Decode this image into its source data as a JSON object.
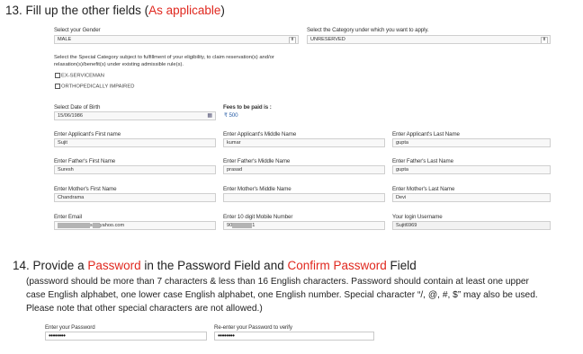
{
  "step13": {
    "number": "13.",
    "text": "Fill up the other fields (",
    "highlight": "As applicable",
    "close": ")"
  },
  "form": {
    "gender": {
      "label": "Select your Gender",
      "value": "MALE"
    },
    "category": {
      "label": "Select the Category under which you want to apply.",
      "value": "UNRESERVED"
    },
    "special_category": {
      "label_line1": "Select the Special Category subject to fulfillment of your eligibility, to claim reservation(s) and/or",
      "label_line2": "relaxation(s)/benefit(s) under existing admissible rule(s).",
      "options": [
        "EX-SERVICEMAN",
        "ORTHOPEDICALLY IMPAIRED"
      ]
    },
    "dob": {
      "label": "Select Date of Birth",
      "value": "15/06/1986"
    },
    "fees": {
      "label": "Fees to be paid is :",
      "value": "₹ 500"
    },
    "applicant_first": {
      "label": "Enter Applicant's First name",
      "value": "Sujit"
    },
    "applicant_middle": {
      "label": "Enter Applicant's Middle Name",
      "value": "kumar"
    },
    "applicant_last": {
      "label": "Enter Applicant's Last Name",
      "value": "gupta"
    },
    "father_first": {
      "label": "Enter Father's First Name",
      "value": "Suresh"
    },
    "father_middle": {
      "label": "Enter Father's Middle Name",
      "value": "prasad"
    },
    "father_last": {
      "label": "Enter Father's Last Name",
      "value": "gupta"
    },
    "mother_first": {
      "label": "Enter Mother's First Name",
      "value": "Chandrama"
    },
    "mother_middle": {
      "label": "Enter Mother's Middle Name",
      "value": ""
    },
    "mother_last": {
      "label": "Enter Mother's Last Name",
      "value": "Devi"
    },
    "email": {
      "label": "Enter Email",
      "value_prefix": "s",
      "value_suffix": "yahoo.com"
    },
    "mobile": {
      "label": "Enter 10 digit Mobile Number",
      "value_prefix": "90",
      "value_suffix": "1"
    },
    "username": {
      "label": "Your login Username",
      "value": "Sujit6969"
    }
  },
  "step14": {
    "number": "14.",
    "pre": "Provide a ",
    "pw": "Password",
    "mid": " in the Password Field and ",
    "cpw": "Confirm Password",
    "post": " Field",
    "note_line1": "(password should be more than 7 characters & less than 16 English characters. Password should contain at least one upper",
    "note_line2": "case English alphabet, one lower case English alphabet, one English number.  Special character “/, @, #, $” may also be used.",
    "note_line3": "Please note that other special characters are not allowed.)"
  },
  "password_form": {
    "password": {
      "label": "Enter your Password",
      "value": "••••••••"
    },
    "confirm": {
      "label": "Re-enter your Password to verify",
      "value": "••••••••"
    }
  },
  "colors": {
    "accent_red": "#e0281f"
  },
  "icons": {
    "select_arrow": "updown-caret-icon",
    "calendar": "calendar-icon",
    "checkbox": "checkbox-icon"
  }
}
